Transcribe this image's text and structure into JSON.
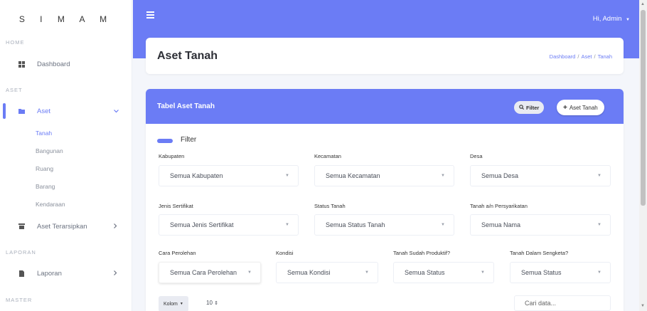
{
  "brand": "S I M A M",
  "sidebar": {
    "sections": {
      "home": "HOME",
      "aset": "ASET",
      "laporan": "LAPORAN",
      "master": "MASTER"
    },
    "items": {
      "dashboard": "Dashboard",
      "aset": "Aset",
      "aset_terarsipkan": "Aset Terarsipkan",
      "laporan": "Laporan"
    },
    "aset_sub": [
      "Tanah",
      "Bangunan",
      "Ruang",
      "Barang",
      "Kendaraan"
    ]
  },
  "header": {
    "greeting": "Hi, Admin"
  },
  "page": {
    "title": "Aset Tanah",
    "breadcrumb": [
      "Dashboard",
      "Aset",
      "Tanah"
    ]
  },
  "table_card": {
    "title": "Tabel Aset Tanah",
    "filter_button": "Filter",
    "add_button": "Aset Tanah",
    "filter_toggle_label": "Filter"
  },
  "filters": {
    "kabupaten": {
      "label": "Kabupaten",
      "value": "Semua Kabupaten"
    },
    "kecamatan": {
      "label": "Kecamatan",
      "value": "Semua Kecamatan"
    },
    "desa": {
      "label": "Desa",
      "value": "Semua Desa"
    },
    "jenis_sertifikat": {
      "label": "Jenis Sertifikat",
      "value": "Semua Jenis Sertifikat"
    },
    "status_tanah": {
      "label": "Status Tanah",
      "value": "Semua Status Tanah"
    },
    "tanah_an": {
      "label": "Tanah a/n Persyarikatan",
      "value": "Semua Nama"
    },
    "cara_perolehan": {
      "label": "Cara Perolehan",
      "value": "Semua Cara Perolehan"
    },
    "kondisi": {
      "label": "Kondisi",
      "value": "Semua Kondisi"
    },
    "produktif": {
      "label": "Tanah Sudah Produktif?",
      "value": "Semua Status"
    },
    "sengketa": {
      "label": "Tanah Dalam Sengketa?",
      "value": "Semua Status"
    }
  },
  "table_controls": {
    "kolom": "Kolom",
    "per_page": "10",
    "search_placeholder": "Cari data..."
  },
  "colors": {
    "accent": "#6b7cf5",
    "background": "#f4f6fb"
  }
}
